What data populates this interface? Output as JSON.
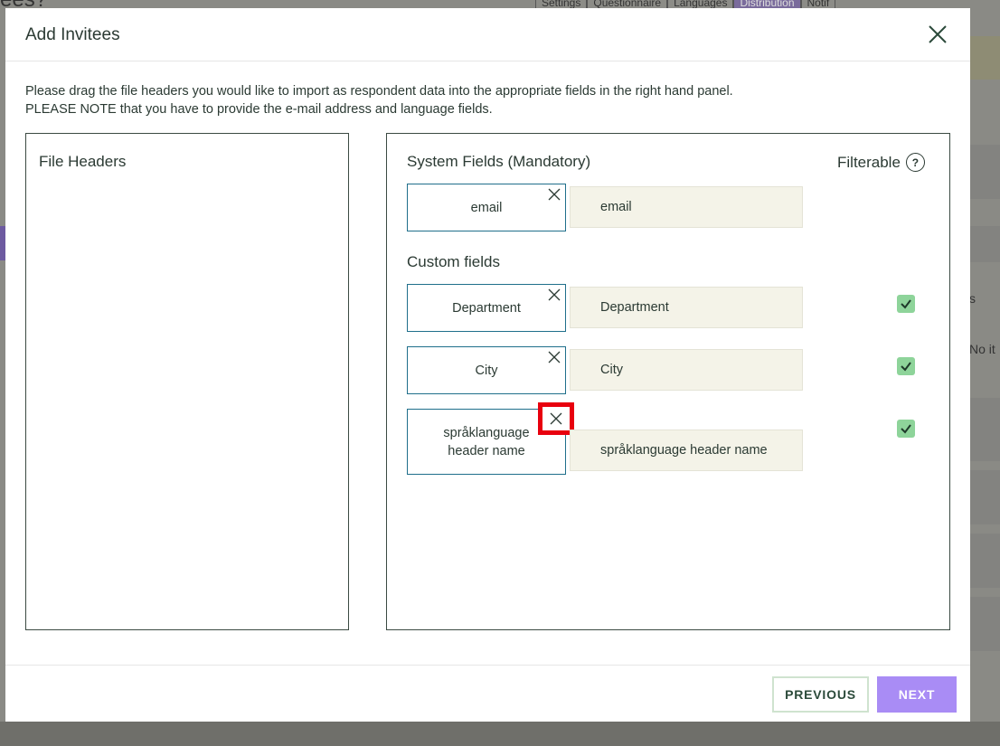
{
  "background": {
    "page_title": "ees?",
    "steps": [
      "Settings",
      "Questionnaire",
      "Languages",
      "Distribution",
      "Notif"
    ],
    "right_text_1": "s",
    "right_text_2": "No it"
  },
  "modal": {
    "title": "Add Invitees",
    "instructions_line1": "Please drag the file headers you would like to import as respondent data into the appropriate fields in the right hand panel.",
    "instructions_line2": "PLEASE NOTE that you have to provide the e-mail address and language fields.",
    "file_headers_title": "File Headers",
    "system_fields_title": "System Fields (Mandatory)",
    "filterable_label": "Filterable",
    "help_icon_text": "?",
    "custom_fields_title": "Custom fields",
    "system_fields": [
      {
        "header": "email",
        "field": "email"
      }
    ],
    "custom_fields": [
      {
        "header": "Department",
        "field": "Department",
        "filterable": true
      },
      {
        "header": "City",
        "field": "City",
        "filterable": true
      },
      {
        "header": "språklanguage header name",
        "field": "språklanguage header name",
        "filterable": true
      }
    ],
    "buttons": {
      "previous": "PREVIOUS",
      "next": "NEXT"
    }
  },
  "colors": {
    "accent": "#a98cf5",
    "chip_border": "#1f6f8b",
    "field_bg": "#f4f3e8",
    "check_bg": "#8ed49a",
    "highlight": "#e8000e"
  }
}
